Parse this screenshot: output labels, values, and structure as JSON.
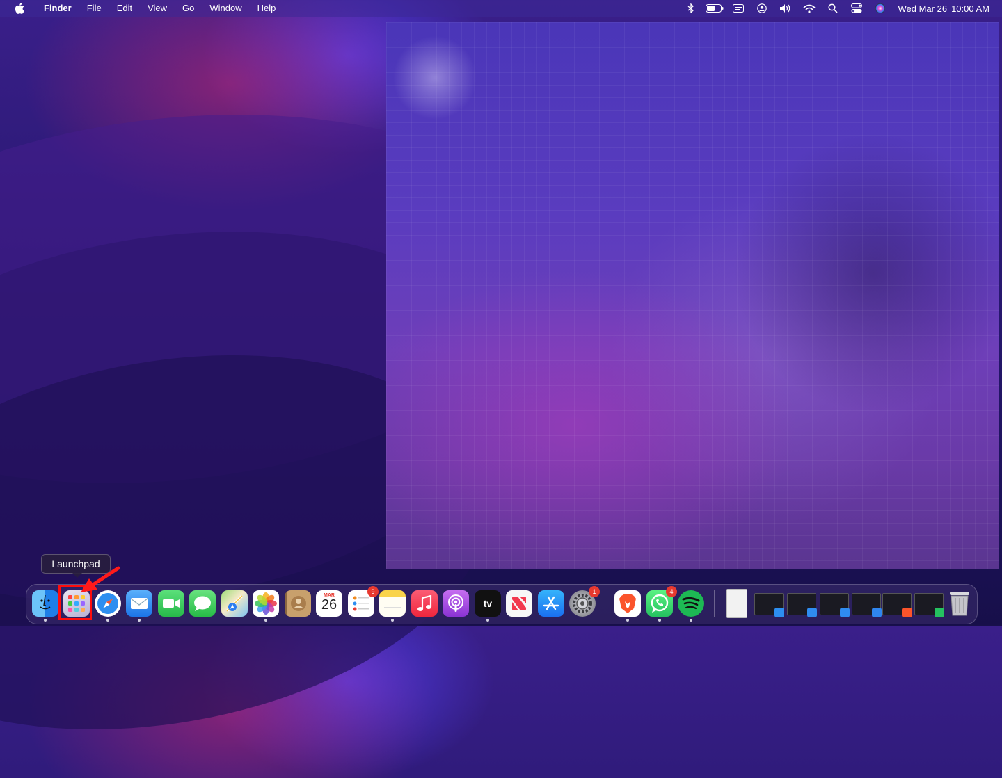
{
  "menubar": {
    "app_name": "Finder",
    "menus": [
      "File",
      "Edit",
      "View",
      "Go",
      "Window",
      "Help"
    ],
    "status_icons": [
      "bluetooth-icon",
      "battery-icon",
      "display-icon",
      "user-icon",
      "volume-icon",
      "wifi-icon",
      "search-icon",
      "control-center-icon",
      "siri-icon"
    ],
    "date": "Wed Mar 26",
    "time": "10:00 AM"
  },
  "tooltip": {
    "label": "Launchpad"
  },
  "dock": {
    "apps": [
      {
        "name": "finder-app",
        "icon": "finder-icon",
        "color": "#2f8cf1",
        "running": true
      },
      {
        "name": "launchpad-app",
        "icon": "launchpad-icon",
        "color": "#d7d0e8",
        "running": false
      },
      {
        "name": "safari-app",
        "icon": "safari-icon",
        "color": "#2d8ef0",
        "running": true
      },
      {
        "name": "mail-app",
        "icon": "mail-icon",
        "color": "#2f86f0",
        "running": true
      },
      {
        "name": "facetime-app",
        "icon": "facetime-icon",
        "color": "#35c458",
        "running": false
      },
      {
        "name": "messages-app",
        "icon": "messages-icon",
        "color": "#38c755",
        "running": false
      },
      {
        "name": "maps-app",
        "icon": "maps-icon",
        "color": "#5ab6f0",
        "running": false
      },
      {
        "name": "photos-app",
        "icon": "photos-icon",
        "color": "#f1f1f1",
        "running": true
      },
      {
        "name": "contacts-app",
        "icon": "contacts-icon",
        "color": "#b18a5c",
        "running": false
      },
      {
        "name": "calendar-app",
        "icon": "calendar-icon",
        "color": "#ffffff",
        "running": false,
        "month": "MAR",
        "day": "26"
      },
      {
        "name": "reminders-app",
        "icon": "reminders-icon",
        "color": "#ffffff",
        "running": false,
        "badge": "9"
      },
      {
        "name": "notes-app",
        "icon": "notes-icon",
        "color": "#fbe38a",
        "running": true
      },
      {
        "name": "music-app",
        "icon": "music-icon",
        "color": "#f2394e",
        "running": false
      },
      {
        "name": "podcasts-app",
        "icon": "podcasts-icon",
        "color": "#a64fe0",
        "running": false
      },
      {
        "name": "tv-app",
        "icon": "appletv-icon",
        "color": "#111111",
        "running": true,
        "label": "tv"
      },
      {
        "name": "news-app",
        "icon": "news-icon",
        "color": "#f7f7f7",
        "running": false
      },
      {
        "name": "appstore-app",
        "icon": "appstore-icon",
        "color": "#2f8df0",
        "running": false
      },
      {
        "name": "settings-app",
        "icon": "gear-icon",
        "color": "#8e8e93",
        "running": false,
        "badge": "1"
      },
      {
        "name": "brave-app",
        "icon": "brave-icon",
        "color": "#ffffff",
        "running": true
      },
      {
        "name": "whatsapp-app",
        "icon": "whatsapp-icon",
        "color": "#2fd366",
        "running": true,
        "badge": "4"
      },
      {
        "name": "spotify-app",
        "icon": "spotify-icon",
        "color": "#1db954",
        "running": true
      }
    ],
    "minimized": [
      "document-thumbnail",
      "safari-window-thumbnail",
      "finder-window-thumbnail",
      "finder-window-thumbnail-2",
      "mail-window-thumbnail",
      "brave-window-thumbnail",
      "whatsapp-window-thumbnail"
    ],
    "trash": "trash-icon"
  }
}
